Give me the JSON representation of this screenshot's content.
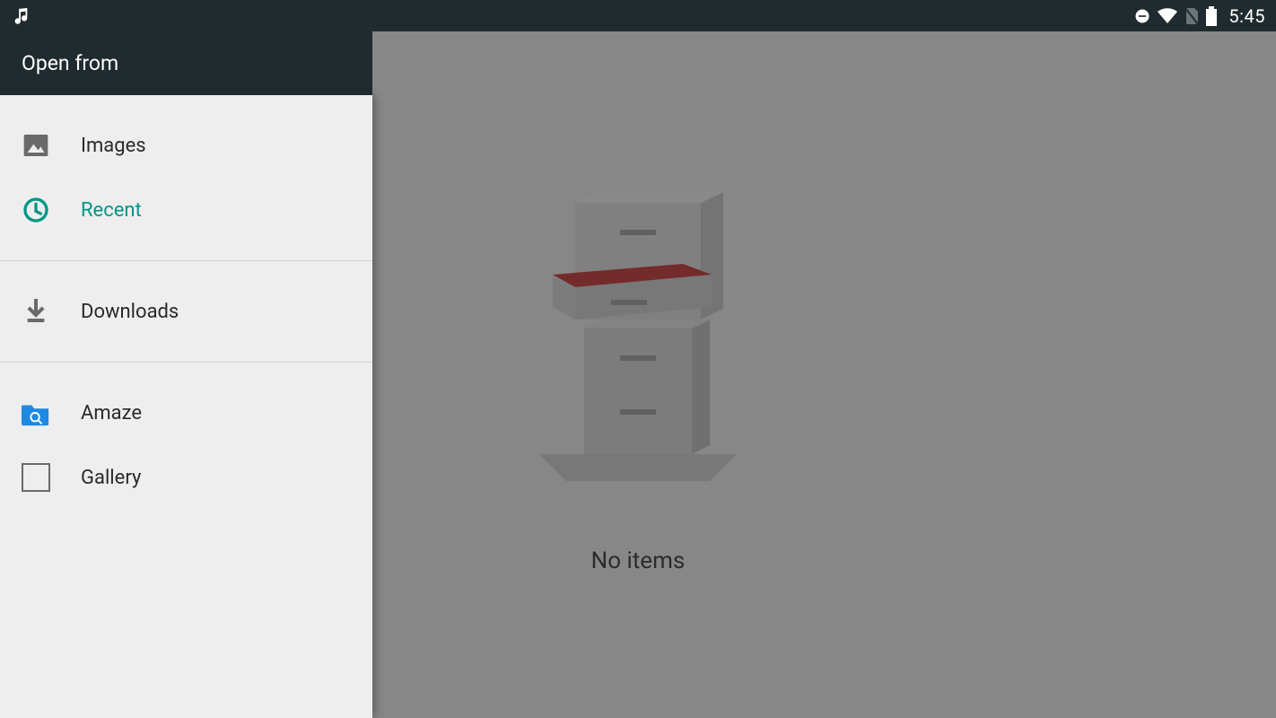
{
  "status": {
    "time": "5:45"
  },
  "app_bar": {},
  "drawer": {
    "title": "Open from",
    "items": [
      {
        "label": "Images",
        "icon": "image-icon",
        "active": false
      },
      {
        "label": "Recent",
        "icon": "clock-icon",
        "active": true
      }
    ],
    "storage_items": [
      {
        "label": "Downloads",
        "icon": "download-icon"
      }
    ],
    "app_items": [
      {
        "label": "Amaze",
        "icon": "amaze-icon"
      },
      {
        "label": "Gallery",
        "icon": "gallery-icon"
      }
    ]
  },
  "main": {
    "empty_text": "No items"
  }
}
